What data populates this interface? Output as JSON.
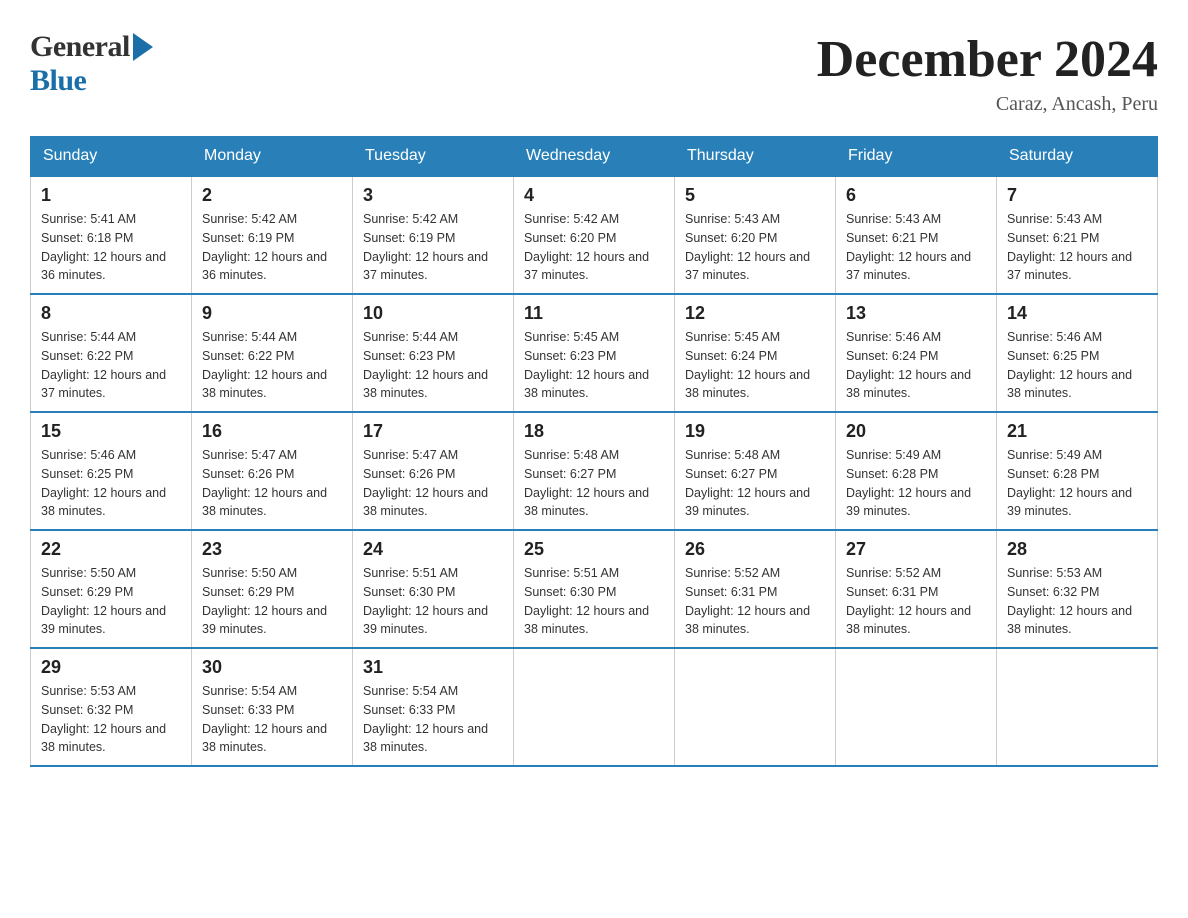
{
  "header": {
    "logo_general": "General",
    "logo_blue": "Blue",
    "main_title": "December 2024",
    "subtitle": "Caraz, Ancash, Peru"
  },
  "calendar": {
    "headers": [
      "Sunday",
      "Monday",
      "Tuesday",
      "Wednesday",
      "Thursday",
      "Friday",
      "Saturday"
    ],
    "weeks": [
      [
        {
          "day": "1",
          "sunrise": "5:41 AM",
          "sunset": "6:18 PM",
          "daylight": "12 hours and 36 minutes."
        },
        {
          "day": "2",
          "sunrise": "5:42 AM",
          "sunset": "6:19 PM",
          "daylight": "12 hours and 36 minutes."
        },
        {
          "day": "3",
          "sunrise": "5:42 AM",
          "sunset": "6:19 PM",
          "daylight": "12 hours and 37 minutes."
        },
        {
          "day": "4",
          "sunrise": "5:42 AM",
          "sunset": "6:20 PM",
          "daylight": "12 hours and 37 minutes."
        },
        {
          "day": "5",
          "sunrise": "5:43 AM",
          "sunset": "6:20 PM",
          "daylight": "12 hours and 37 minutes."
        },
        {
          "day": "6",
          "sunrise": "5:43 AM",
          "sunset": "6:21 PM",
          "daylight": "12 hours and 37 minutes."
        },
        {
          "day": "7",
          "sunrise": "5:43 AM",
          "sunset": "6:21 PM",
          "daylight": "12 hours and 37 minutes."
        }
      ],
      [
        {
          "day": "8",
          "sunrise": "5:44 AM",
          "sunset": "6:22 PM",
          "daylight": "12 hours and 37 minutes."
        },
        {
          "day": "9",
          "sunrise": "5:44 AM",
          "sunset": "6:22 PM",
          "daylight": "12 hours and 38 minutes."
        },
        {
          "day": "10",
          "sunrise": "5:44 AM",
          "sunset": "6:23 PM",
          "daylight": "12 hours and 38 minutes."
        },
        {
          "day": "11",
          "sunrise": "5:45 AM",
          "sunset": "6:23 PM",
          "daylight": "12 hours and 38 minutes."
        },
        {
          "day": "12",
          "sunrise": "5:45 AM",
          "sunset": "6:24 PM",
          "daylight": "12 hours and 38 minutes."
        },
        {
          "day": "13",
          "sunrise": "5:46 AM",
          "sunset": "6:24 PM",
          "daylight": "12 hours and 38 minutes."
        },
        {
          "day": "14",
          "sunrise": "5:46 AM",
          "sunset": "6:25 PM",
          "daylight": "12 hours and 38 minutes."
        }
      ],
      [
        {
          "day": "15",
          "sunrise": "5:46 AM",
          "sunset": "6:25 PM",
          "daylight": "12 hours and 38 minutes."
        },
        {
          "day": "16",
          "sunrise": "5:47 AM",
          "sunset": "6:26 PM",
          "daylight": "12 hours and 38 minutes."
        },
        {
          "day": "17",
          "sunrise": "5:47 AM",
          "sunset": "6:26 PM",
          "daylight": "12 hours and 38 minutes."
        },
        {
          "day": "18",
          "sunrise": "5:48 AM",
          "sunset": "6:27 PM",
          "daylight": "12 hours and 38 minutes."
        },
        {
          "day": "19",
          "sunrise": "5:48 AM",
          "sunset": "6:27 PM",
          "daylight": "12 hours and 39 minutes."
        },
        {
          "day": "20",
          "sunrise": "5:49 AM",
          "sunset": "6:28 PM",
          "daylight": "12 hours and 39 minutes."
        },
        {
          "day": "21",
          "sunrise": "5:49 AM",
          "sunset": "6:28 PM",
          "daylight": "12 hours and 39 minutes."
        }
      ],
      [
        {
          "day": "22",
          "sunrise": "5:50 AM",
          "sunset": "6:29 PM",
          "daylight": "12 hours and 39 minutes."
        },
        {
          "day": "23",
          "sunrise": "5:50 AM",
          "sunset": "6:29 PM",
          "daylight": "12 hours and 39 minutes."
        },
        {
          "day": "24",
          "sunrise": "5:51 AM",
          "sunset": "6:30 PM",
          "daylight": "12 hours and 39 minutes."
        },
        {
          "day": "25",
          "sunrise": "5:51 AM",
          "sunset": "6:30 PM",
          "daylight": "12 hours and 38 minutes."
        },
        {
          "day": "26",
          "sunrise": "5:52 AM",
          "sunset": "6:31 PM",
          "daylight": "12 hours and 38 minutes."
        },
        {
          "day": "27",
          "sunrise": "5:52 AM",
          "sunset": "6:31 PM",
          "daylight": "12 hours and 38 minutes."
        },
        {
          "day": "28",
          "sunrise": "5:53 AM",
          "sunset": "6:32 PM",
          "daylight": "12 hours and 38 minutes."
        }
      ],
      [
        {
          "day": "29",
          "sunrise": "5:53 AM",
          "sunset": "6:32 PM",
          "daylight": "12 hours and 38 minutes."
        },
        {
          "day": "30",
          "sunrise": "5:54 AM",
          "sunset": "6:33 PM",
          "daylight": "12 hours and 38 minutes."
        },
        {
          "day": "31",
          "sunrise": "5:54 AM",
          "sunset": "6:33 PM",
          "daylight": "12 hours and 38 minutes."
        },
        null,
        null,
        null,
        null
      ]
    ]
  }
}
